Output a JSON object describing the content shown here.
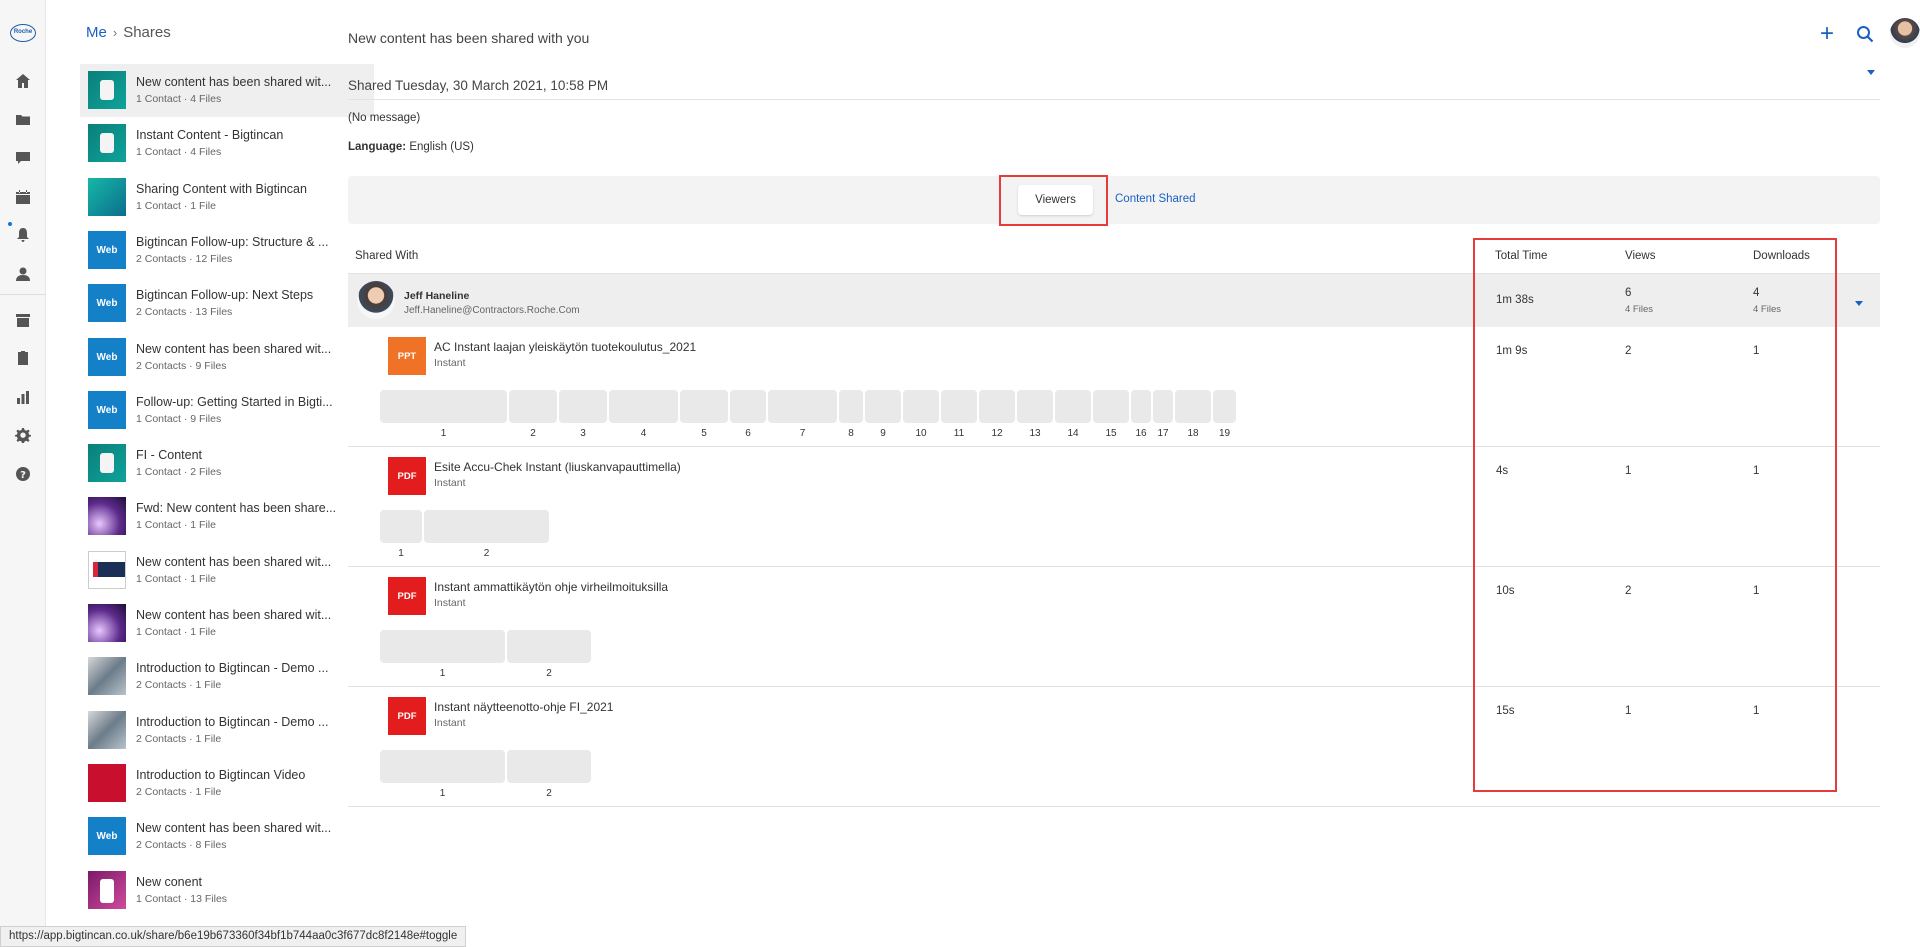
{
  "breadcrumb": {
    "me": "Me",
    "current": "Shares"
  },
  "rail": {
    "logo": "Roche",
    "icons": [
      "home-icon",
      "folder-icon",
      "chat-icon",
      "calendar-icon",
      "bell-icon",
      "user-icon",
      "archive-icon",
      "clipboard-icon",
      "bar-chart-icon",
      "gear-icon",
      "help-icon"
    ]
  },
  "shares": [
    {
      "title": "New content has been shared wit...",
      "sub": "1 Contact · 4 Files",
      "thumb": "teal",
      "label": ""
    },
    {
      "title": "Instant Content - Bigtincan",
      "sub": "1 Contact · 4 Files",
      "thumb": "teal",
      "label": ""
    },
    {
      "title": "Sharing Content with Bigtincan",
      "sub": "1 Contact · 1 File",
      "thumb": "tealbig",
      "label": ""
    },
    {
      "title": "Bigtincan Follow-up: Structure & ...",
      "sub": "2 Contacts · 12 Files",
      "thumb": "web",
      "label": "Web"
    },
    {
      "title": "Bigtincan Follow-up: Next Steps",
      "sub": "2 Contacts · 13 Files",
      "thumb": "web",
      "label": "Web"
    },
    {
      "title": "New content has been shared wit...",
      "sub": "2 Contacts · 9 Files",
      "thumb": "web",
      "label": "Web"
    },
    {
      "title": "Follow-up: Getting Started in Bigti...",
      "sub": "1 Contact · 9 Files",
      "thumb": "web",
      "label": "Web"
    },
    {
      "title": "FI - Content",
      "sub": "1 Contact · 2 Files",
      "thumb": "teal",
      "label": ""
    },
    {
      "title": "Fwd: New content has been share...",
      "sub": "1 Contact · 1 File",
      "thumb": "purple",
      "label": ""
    },
    {
      "title": "New content has been shared wit...",
      "sub": "1 Contact · 1 File",
      "thumb": "screen",
      "label": ""
    },
    {
      "title": "New content has been shared wit...",
      "sub": "1 Contact · 1 File",
      "thumb": "purple",
      "label": ""
    },
    {
      "title": "Introduction to Bigtincan - Demo ...",
      "sub": "2 Contacts · 1 File",
      "thumb": "photo",
      "label": ""
    },
    {
      "title": "Introduction to Bigtincan - Demo ...",
      "sub": "2 Contacts · 1 File",
      "thumb": "photo",
      "label": ""
    },
    {
      "title": "Introduction to Bigtincan Video",
      "sub": "2 Contacts · 1 File",
      "thumb": "red",
      "label": ""
    },
    {
      "title": "New content has been shared wit...",
      "sub": "2 Contacts · 8 Files",
      "thumb": "web",
      "label": "Web"
    },
    {
      "title": "New conent",
      "sub": "1 Contact · 13 Files",
      "thumb": "magenta",
      "label": ""
    }
  ],
  "main": {
    "title": "New content has been shared with you",
    "shared_date": "Shared Tuesday, 30 March 2021, 10:58 PM",
    "message": "(No message)",
    "language_label": "Language:",
    "language_value": "English (US)",
    "tabs": {
      "viewers": "Viewers",
      "content_shared": "Content Shared"
    }
  },
  "table": {
    "headers": {
      "shared_with": "Shared With",
      "total_time": "Total Time",
      "views": "Views",
      "downloads": "Downloads"
    },
    "viewer": {
      "name": "Jeff Haneline",
      "email": "Jeff.Haneline@Contractors.Roche.Com",
      "total_time": "1m 38s",
      "views": "6",
      "views_sub": "4 Files",
      "downloads": "4",
      "downloads_sub": "4 Files"
    },
    "files": [
      {
        "icon": "PPT",
        "name": "AC Instant laajan yleiskäytön tuotekoulutus_2021",
        "type": "Instant",
        "total_time": "1m 9s",
        "views": "2",
        "downloads": "1",
        "pages": [
          "1",
          "2",
          "3",
          "4",
          "5",
          "6",
          "7",
          "8",
          "9",
          "10",
          "11",
          "12",
          "13",
          "14",
          "15",
          "16",
          "17",
          "18",
          "19"
        ]
      },
      {
        "icon": "PDF",
        "name": "Esite Accu-Chek Instant (liuskanvapauttimella)",
        "type": "Instant",
        "total_time": "4s",
        "views": "1",
        "downloads": "1",
        "pages": [
          "1",
          "2"
        ]
      },
      {
        "icon": "PDF",
        "name": "Instant ammattikäytön ohje virheilmoituksilla",
        "type": "Instant",
        "total_time": "10s",
        "views": "2",
        "downloads": "1",
        "pages": [
          "1",
          "2"
        ]
      },
      {
        "icon": "PDF",
        "name": "Instant näytteenotto-ohje FI_2021",
        "type": "Instant",
        "total_time": "15s",
        "views": "1",
        "downloads": "1",
        "pages": [
          "1",
          "2"
        ]
      }
    ]
  },
  "status_url": "https://app.bigtincan.co.uk/share/b6e19b673360f34bf1b744aa0c3f677dc8f2148e#toggle",
  "colors": {
    "accent": "#1a60c0",
    "highlight": "#e53b3b",
    "ppt": "#f07226",
    "pdf": "#e31d1d"
  }
}
